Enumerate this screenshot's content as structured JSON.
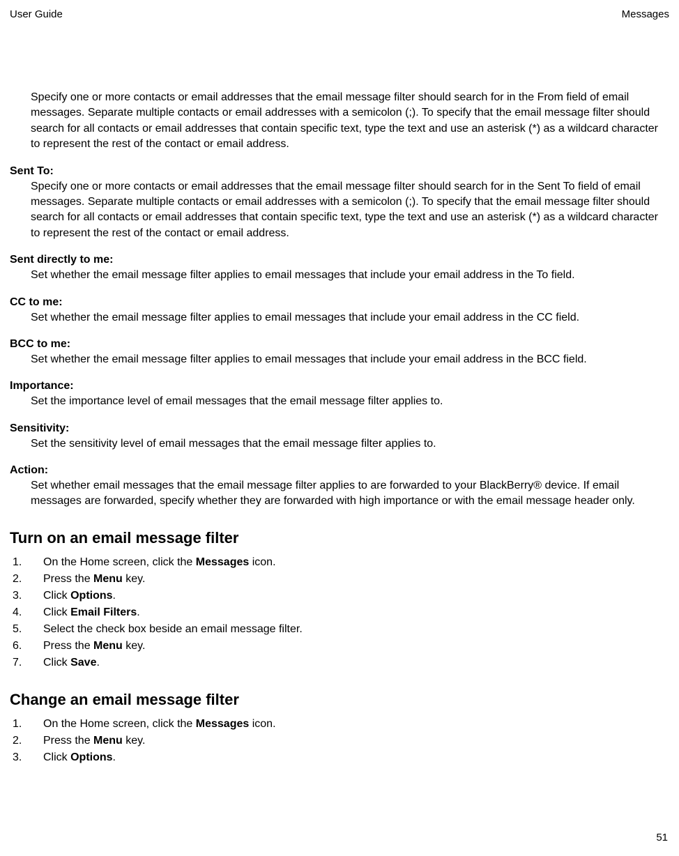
{
  "header": {
    "left": "User Guide",
    "right": "Messages"
  },
  "intro": "Specify one or more contacts or email addresses that the email message filter should search for in the From field of email messages. Separate multiple contacts or email addresses with a semicolon (;). To specify that the email message filter should search for all contacts or email addresses that contain specific text, type the text and use an asterisk (*) as a wildcard character to represent the rest of the contact or email address.",
  "terms": [
    {
      "label": "Sent To:",
      "desc": "Specify one or more contacts or email addresses that the email message filter should search for in the Sent To field of email messages. Separate multiple contacts or email addresses with a semicolon (;). To specify that the email message filter should search for all contacts or email addresses that contain specific text, type the text and use an asterisk (*) as a wildcard character to represent the rest of the contact or email address."
    },
    {
      "label": "Sent directly to me:",
      "desc": "Set whether the email message filter applies to email messages that include your email address in the To field."
    },
    {
      "label": "CC to me:",
      "desc": "Set whether the email message filter applies to email messages that include your email address in the CC field."
    },
    {
      "label": "BCC to me:",
      "desc": "Set whether the email message filter applies to email messages that include your email address in the BCC field."
    },
    {
      "label": "Importance:",
      "desc": "Set the importance level of email messages that the email message filter applies to."
    },
    {
      "label": "Sensitivity:",
      "desc": "Set the sensitivity level of email messages that the email message filter applies to."
    },
    {
      "label": "Action:",
      "desc": "Set whether email messages that the email message filter applies to are forwarded to your BlackBerry® device. If email messages are forwarded, specify whether they are forwarded with high importance or with the email message header only."
    }
  ],
  "section1": {
    "heading": "Turn on an email message filter",
    "steps": [
      {
        "pre": "On the Home screen, click the ",
        "bold": "Messages",
        "post": " icon."
      },
      {
        "pre": "Press the ",
        "bold": "Menu",
        "post": " key."
      },
      {
        "pre": "Click ",
        "bold": "Options",
        "post": "."
      },
      {
        "pre": "Click ",
        "bold": "Email Filters",
        "post": "."
      },
      {
        "pre": "Select the check box beside an email message filter.",
        "bold": "",
        "post": ""
      },
      {
        "pre": "Press the ",
        "bold": "Menu",
        "post": " key."
      },
      {
        "pre": "Click ",
        "bold": "Save",
        "post": "."
      }
    ]
  },
  "section2": {
    "heading": "Change an email message filter",
    "steps": [
      {
        "pre": "On the Home screen, click the ",
        "bold": "Messages",
        "post": " icon."
      },
      {
        "pre": "Press the ",
        "bold": "Menu",
        "post": " key."
      },
      {
        "pre": "Click ",
        "bold": "Options",
        "post": "."
      }
    ]
  },
  "pageNumber": "51"
}
